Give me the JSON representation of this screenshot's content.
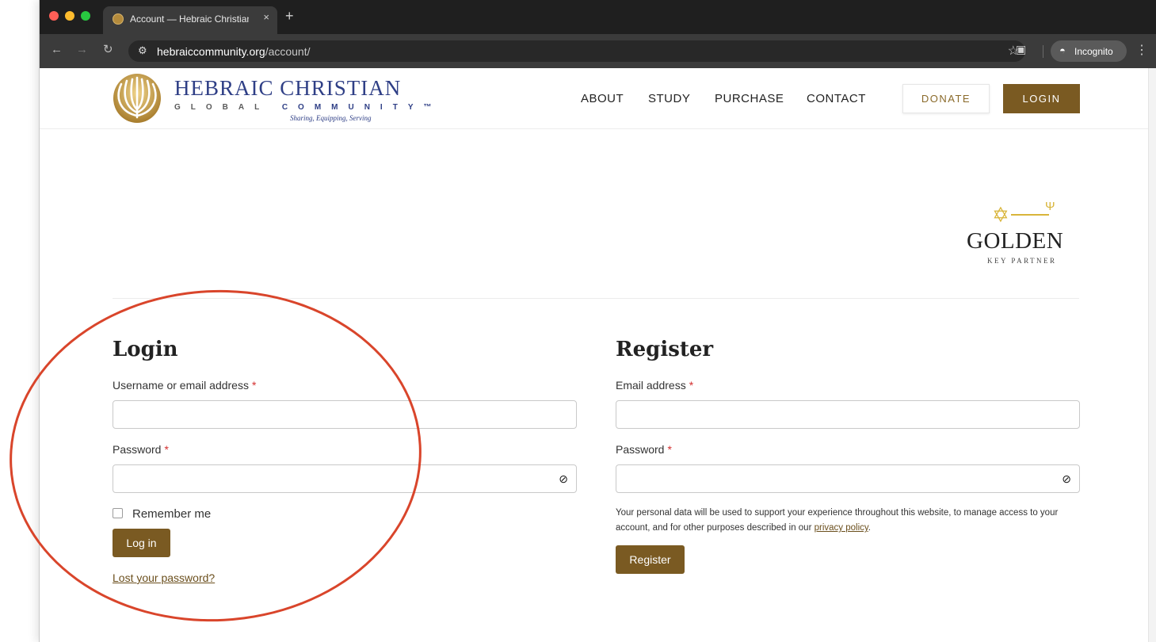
{
  "browser": {
    "tab_title": "Account — Hebraic Christian",
    "tab_close": "×",
    "new_tab": "+",
    "url_domain": "hebraiccommunity.org",
    "url_path": "/account/",
    "incognito_label": "Incognito"
  },
  "site": {
    "logo_title": "HEBRAIC CHRISTIAN",
    "logo_sub_1": "GLOBAL",
    "logo_sub_2": "COMMUNITY™",
    "logo_tagline": "Sharing, Equipping, Serving",
    "nav": [
      "ABOUT",
      "STUDY",
      "PURCHASE",
      "CONTACT"
    ],
    "donate_label": "DONATE",
    "login_label": "LOGIN"
  },
  "badge": {
    "word": "GOLDEN",
    "sub": "KEY PARTNER"
  },
  "login": {
    "heading": "Login",
    "username_label": "Username or email address",
    "required_mark": "*",
    "password_label": "Password",
    "remember_label": "Remember me",
    "submit_label": "Log in",
    "lost_password": "Lost your password?"
  },
  "register": {
    "heading": "Register",
    "email_label": "Email address",
    "password_label": "Password",
    "privacy_text": "Your personal data will be used to support your experience throughout this website, to manage access to your account, and for other purposes described in our",
    "privacy_link": "privacy policy",
    "privacy_end": ".",
    "submit_label": "Register"
  },
  "colors": {
    "brand_brown": "#7a5a22",
    "brand_blue": "#2f3f86",
    "gold": "#d9b53a",
    "annotation_red": "#d9452b"
  }
}
